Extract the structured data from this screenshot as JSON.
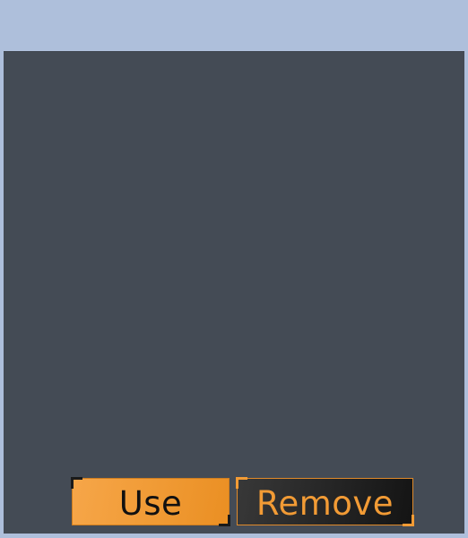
{
  "buttons": {
    "use_label": "Use",
    "remove_label": "Remove"
  },
  "colors": {
    "background": "#aebfdb",
    "panel": "#444b55",
    "accent": "#f09a34",
    "dark_button": "#262626"
  }
}
